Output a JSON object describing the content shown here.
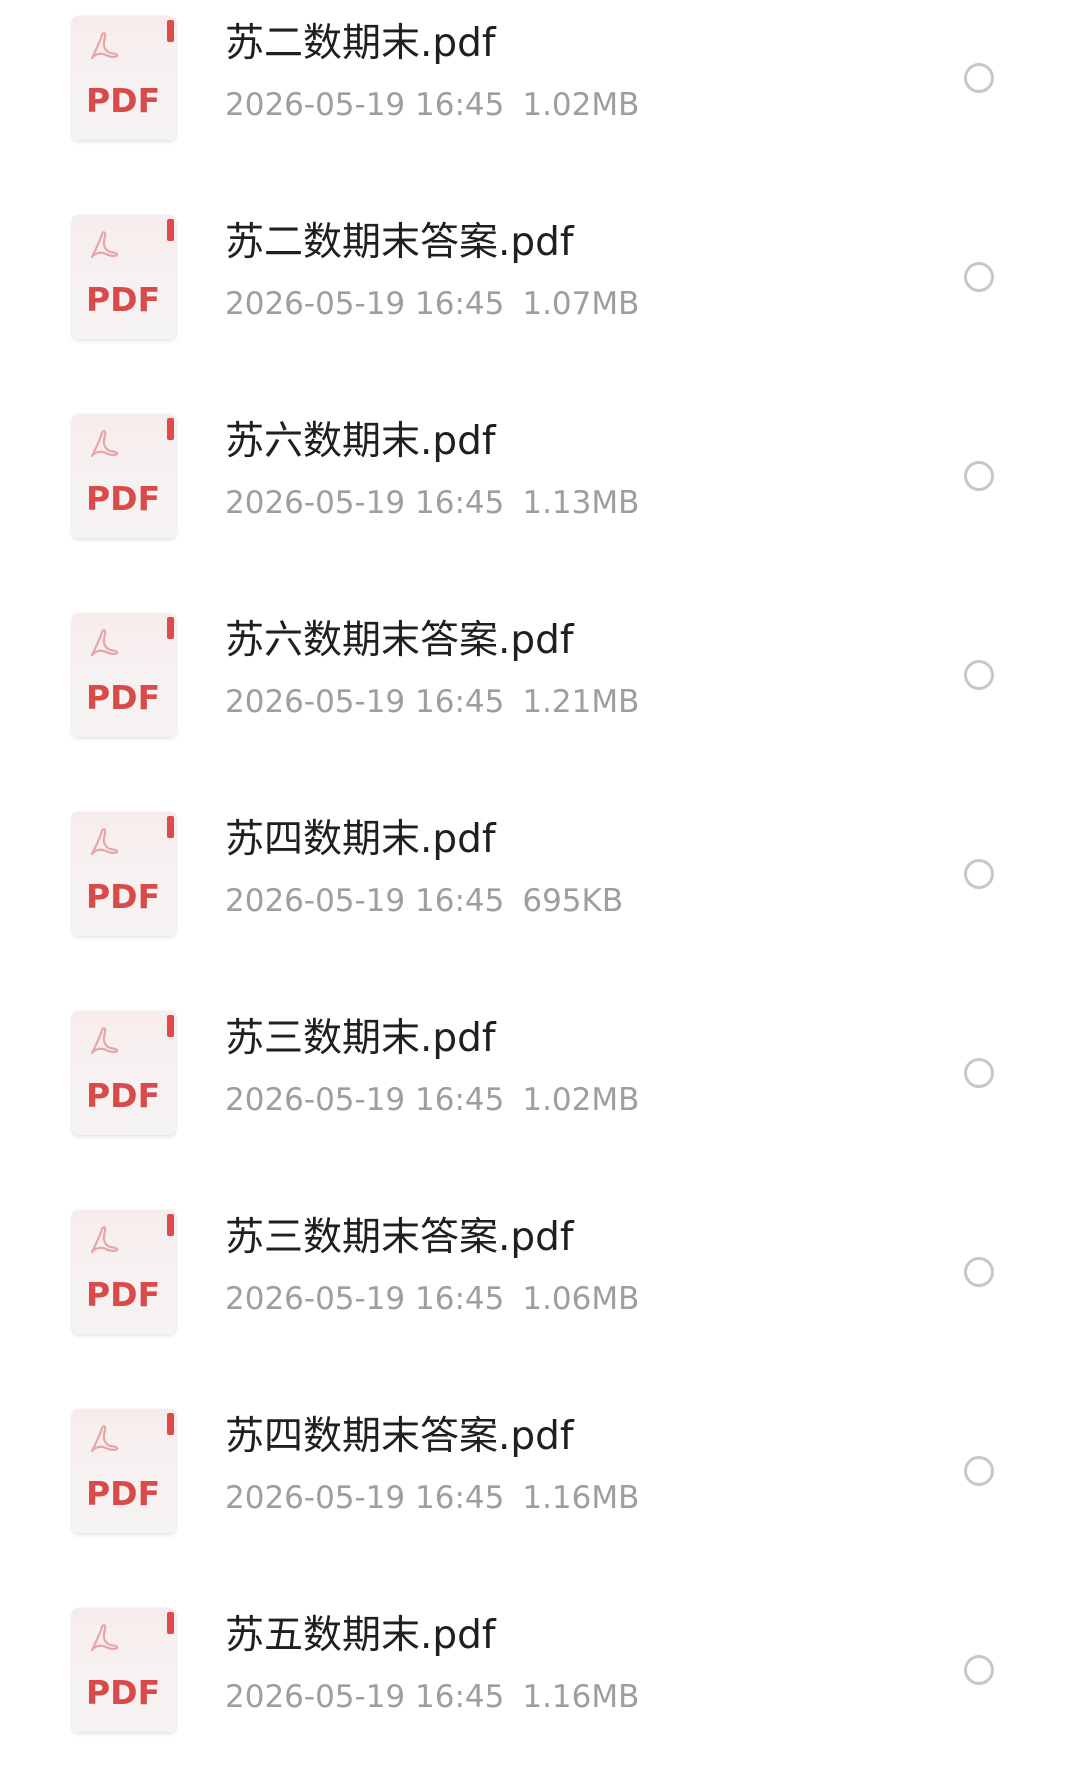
{
  "files": [
    {
      "name": "苏二数期末.pdf",
      "date": "2026-05-19 16:45",
      "size": "1.02MB",
      "icon_label": "PDF"
    },
    {
      "name": "苏二数期末答案.pdf",
      "date": "2026-05-19 16:45",
      "size": "1.07MB",
      "icon_label": "PDF"
    },
    {
      "name": "苏六数期末.pdf",
      "date": "2026-05-19 16:45",
      "size": "1.13MB",
      "icon_label": "PDF"
    },
    {
      "name": "苏六数期末答案.pdf",
      "date": "2026-05-19 16:45",
      "size": "1.21MB",
      "icon_label": "PDF"
    },
    {
      "name": "苏四数期末.pdf",
      "date": "2026-05-19 16:45",
      "size": "695KB",
      "icon_label": "PDF"
    },
    {
      "name": "苏三数期末.pdf",
      "date": "2026-05-19 16:45",
      "size": "1.02MB",
      "icon_label": "PDF"
    },
    {
      "name": "苏三数期末答案.pdf",
      "date": "2026-05-19 16:45",
      "size": "1.06MB",
      "icon_label": "PDF"
    },
    {
      "name": "苏四数期末答案.pdf",
      "date": "2026-05-19 16:45",
      "size": "1.16MB",
      "icon_label": "PDF"
    },
    {
      "name": "苏五数期末.pdf",
      "date": "2026-05-19 16:45",
      "size": "1.16MB",
      "icon_label": "PDF"
    }
  ],
  "colors": {
    "pdf_red": "#d94a4a",
    "name_text": "#1f1f1f",
    "meta_text": "#9e9e9e",
    "radio_border": "#c7c7c7"
  },
  "icons": {
    "file_type": "pdf-file-icon",
    "acrobat": "acrobat-logo-icon",
    "select": "radio-circle-icon"
  }
}
